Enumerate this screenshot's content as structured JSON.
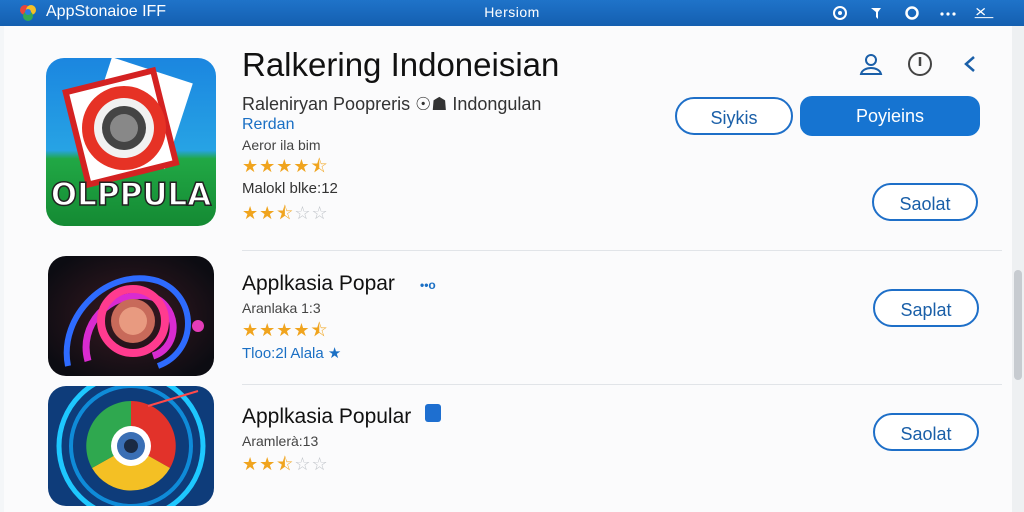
{
  "window": {
    "app_name": "AppStonaioe IFF",
    "center_title": "Hersiom"
  },
  "featured": {
    "title": "Ralkering Indoneisian",
    "developer": "Raleniryan Poopreris ☉☗ Indongulan",
    "category": "Rerdan",
    "rating_label": "Aeror ila bim",
    "rating_stars": 4.5,
    "sub_label": "Malokl blke:12",
    "sub_stars": 2.5,
    "icon_text": "OLPPULA",
    "btn_secondary": "Siykis",
    "btn_primary": "Poyieins",
    "btn_row": "Saolat"
  },
  "list": [
    {
      "title": "Applkasia Popar",
      "badge": "••o",
      "meta": "Aranlaka 1:3",
      "stars": 4.5,
      "link": "Tloo:2l Alala ★",
      "button": "Saplat"
    },
    {
      "title": "Applkasia Popular",
      "meta": "Aramlerà:13",
      "stars": 2.5,
      "button": "Saolat"
    }
  ],
  "colors": {
    "accent": "#1674d1",
    "star": "#f0a41e"
  }
}
